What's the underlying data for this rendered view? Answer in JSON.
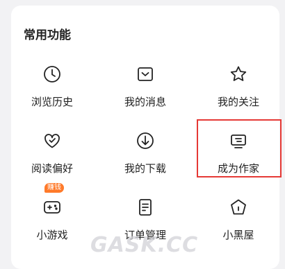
{
  "section": {
    "title": "常用功能"
  },
  "items": [
    {
      "label": "浏览历史",
      "icon": "clock-icon"
    },
    {
      "label": "我的消息",
      "icon": "message-icon"
    },
    {
      "label": "我的关注",
      "icon": "star-icon"
    },
    {
      "label": "阅读偏好",
      "icon": "heart-check-icon"
    },
    {
      "label": "我的下载",
      "icon": "download-icon"
    },
    {
      "label": "成为作家",
      "icon": "writer-screen-icon"
    },
    {
      "label": "小游戏",
      "icon": "gamepad-icon",
      "badge": "赚钱"
    },
    {
      "label": "订单管理",
      "icon": "order-document-icon"
    },
    {
      "label": "小黑屋",
      "icon": "pentagon-house-icon"
    }
  ],
  "watermark": "GASK.CC",
  "colors": {
    "highlight": "#e53935",
    "badge": "#ff7a2a",
    "text": "#222222"
  }
}
